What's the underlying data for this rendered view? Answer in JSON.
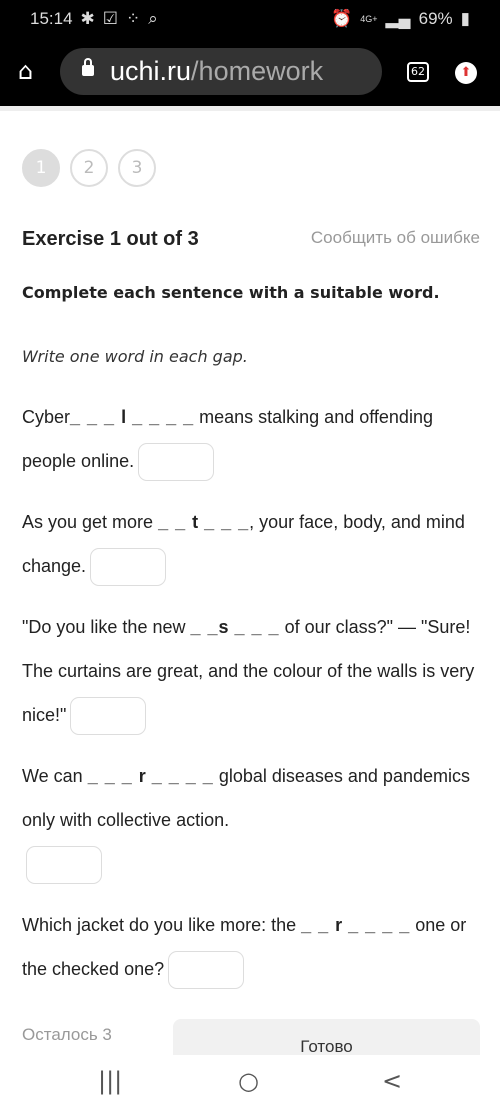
{
  "status": {
    "time": "15:14",
    "battery": "69%",
    "network": "4G+"
  },
  "browser": {
    "url_host": "uchi.ru",
    "url_path": "/homework",
    "tab_count": "62"
  },
  "steps": [
    "1",
    "2",
    "3"
  ],
  "exercise": {
    "title": "Exercise 1 out of 3",
    "report": "Сообщить об ошибке",
    "instruction": "Complete each sentence with a suitable word.",
    "hint": "Write one word in each gap."
  },
  "sentences": [
    {
      "before": "Cyber",
      "gap1": "_ _ _ ",
      "letter": "l",
      "gap2": " _ _ _ _",
      "after": " means stalking and offending people online."
    },
    {
      "before": "As you get more ",
      "gap1": "_ _ ",
      "letter": "t",
      "gap2": " _ _ _",
      "after": ", your face, body, and mind change."
    },
    {
      "before": "\"Do you like the new ",
      "gap1": "_ _",
      "letter": "s",
      "gap2": " _ _ _",
      "after": " of our class?\" — \"Sure! The curtains are great, and the colour of the walls is very nice!\""
    },
    {
      "before": "We can ",
      "gap1": "_ _ _ ",
      "letter": "r",
      "gap2": " _ _ _ _",
      "after": " global diseases and pandemics only with collective action."
    },
    {
      "before": "Which jacket do you like more: the ",
      "gap1": "_ _ ",
      "letter": "r",
      "gap2": " _ _ _ _",
      "after": " one or the checked one?"
    }
  ],
  "footer": {
    "remaining": "Осталось 3",
    "done": "Готово"
  },
  "nav": {
    "recents": "|||",
    "home": "○",
    "back": "<"
  }
}
